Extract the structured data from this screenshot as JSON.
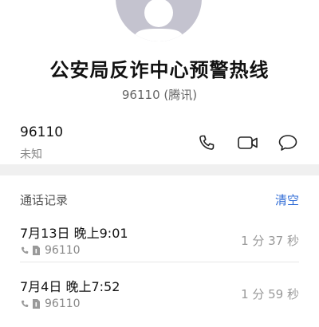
{
  "contact": {
    "name": "公安局反诈中心预警热线",
    "subtitle": "96110 (腾讯)"
  },
  "number": {
    "value": "96110",
    "tag": "未知"
  },
  "actions": {
    "call_icon": "phone-icon",
    "video_icon": "video-call-icon",
    "message_icon": "message-icon"
  },
  "call_log": {
    "title": "通话记录",
    "clear_label": "清空",
    "entries": [
      {
        "date": "7月13日 晚上9:01",
        "number": "96110",
        "duration": "1 分 37 秒"
      },
      {
        "date": "7月4日 晚上7:52",
        "number": "96110",
        "duration": "1 分 59 秒"
      }
    ]
  },
  "colors": {
    "accent": "#2f6bd6",
    "avatar_bg": "#c4c3cf"
  }
}
